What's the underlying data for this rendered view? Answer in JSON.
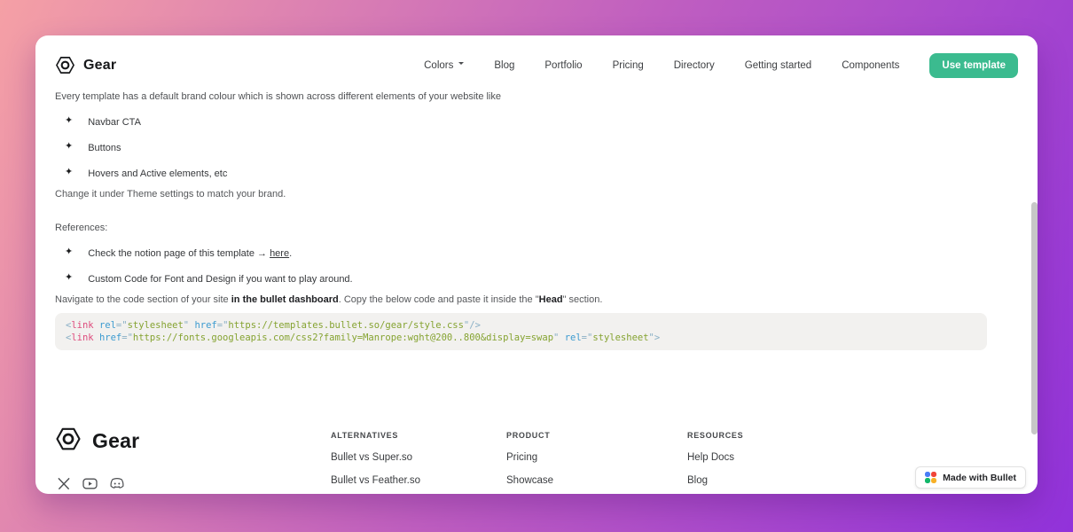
{
  "header": {
    "logo_text": "Gear",
    "nav_items": [
      "Colors",
      "Blog",
      "Portfolio",
      "Pricing",
      "Directory",
      "Getting started",
      "Components"
    ],
    "cta_label": "Use template"
  },
  "main": {
    "intro": "Every template has a default brand colour which is shown across different elements of your website like",
    "brand_bullets": [
      "Navbar CTA",
      "Buttons",
      "Hovers and Active elements, etc"
    ],
    "change_note": "Change it under Theme settings to match your brand.",
    "references_label": "References:",
    "reference_bullets": [
      {
        "segments": [
          {
            "text": "Check the notion page of this template → "
          },
          {
            "text": "here",
            "link": true
          },
          {
            "text": "."
          }
        ]
      },
      {
        "segments": [
          {
            "text": "Custom Code for Font and Design if you want to play around."
          }
        ]
      }
    ],
    "navigate_segments": [
      {
        "text": "Navigate to the code section of your site "
      },
      {
        "text": "in the bullet dashboard",
        "bold": true
      },
      {
        "text": ". Copy the below code and paste it inside the \""
      },
      {
        "text": "Head",
        "bold": true
      },
      {
        "text": "\" section."
      }
    ],
    "code_lines": [
      [
        [
          "pun",
          "<"
        ],
        [
          "tag",
          "link"
        ],
        [
          "pln",
          " "
        ],
        [
          "atn",
          "rel"
        ],
        [
          "pun",
          "=\""
        ],
        [
          "str",
          "stylesheet"
        ],
        [
          "pun",
          "\""
        ],
        [
          "pln",
          " "
        ],
        [
          "atn",
          "href"
        ],
        [
          "pun",
          "=\""
        ],
        [
          "str",
          "https://templates.bullet.so/gear/style.css"
        ],
        [
          "pun",
          "\""
        ],
        [
          "pun",
          "/>"
        ]
      ],
      [
        [
          "pun",
          "<"
        ],
        [
          "tag",
          "link"
        ],
        [
          "pln",
          " "
        ],
        [
          "atn",
          "href"
        ],
        [
          "pun",
          "=\""
        ],
        [
          "str",
          "https://fonts.googleapis.com/css2?family=Manrope:wght@200..800&display=swap"
        ],
        [
          "pun",
          "\""
        ],
        [
          "pln",
          " "
        ],
        [
          "atn",
          "rel"
        ],
        [
          "pun",
          "=\""
        ],
        [
          "str",
          "stylesheet"
        ],
        [
          "pun",
          "\""
        ],
        [
          "pun",
          ">"
        ]
      ]
    ]
  },
  "footer": {
    "logo_text": "Gear",
    "social_icons": [
      "x",
      "youtube",
      "discord"
    ],
    "columns": [
      {
        "heading": "ALTERNATIVES",
        "links": [
          "Bullet vs Super.so",
          "Bullet vs Feather.so"
        ]
      },
      {
        "heading": "PRODUCT",
        "links": [
          "Pricing",
          "Showcase"
        ]
      },
      {
        "heading": "RESOURCES",
        "links": [
          "Help Docs",
          "Blog"
        ]
      }
    ],
    "badge_label": "Made with Bullet"
  },
  "colors": {
    "accent_green": "#3bbb8f",
    "background_gradient_start": "#f5a0a5",
    "background_gradient_end": "#9132da",
    "code_tag": "#de4c7d",
    "code_attribute": "#3c9bd0",
    "code_string": "#85a331",
    "code_punctuation": "#8ab0c6"
  }
}
